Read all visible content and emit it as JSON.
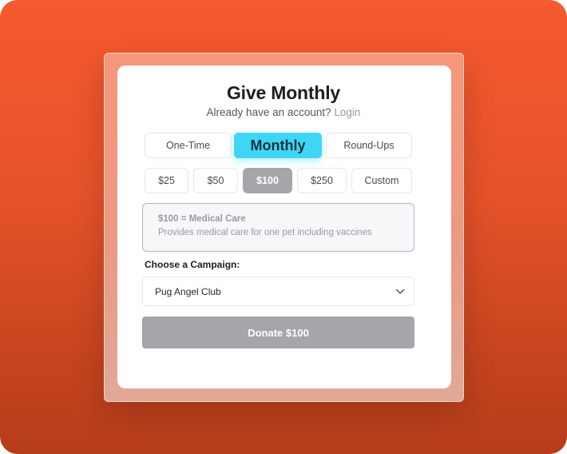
{
  "form": {
    "title": "Give Monthly",
    "subtitle_prefix": "Already have an account?",
    "login_link": "Login"
  },
  "frequency_tabs": [
    {
      "label": "One-Time",
      "selected": false
    },
    {
      "label": "Monthly",
      "selected": true
    },
    {
      "label": "Round-Ups",
      "selected": false
    }
  ],
  "amounts": [
    {
      "label": "$25",
      "selected": false
    },
    {
      "label": "$50",
      "selected": false
    },
    {
      "label": "$100",
      "selected": true
    },
    {
      "label": "$250",
      "selected": false
    },
    {
      "label": "Custom",
      "selected": false
    }
  ],
  "impact": {
    "title": "$100 = Medical Care",
    "description": "Provides medical care for one pet including vaccines"
  },
  "campaign": {
    "label": "Choose a Campaign:",
    "selected": "Pug Angel Club",
    "icon": "chevron-down-icon"
  },
  "donate_button": "Donate $100",
  "colors": {
    "background": "#f65a2e",
    "accent": "#3fd6f6",
    "selected_amount": "#a6a6aa",
    "donate_button": "#a6a6aa"
  }
}
